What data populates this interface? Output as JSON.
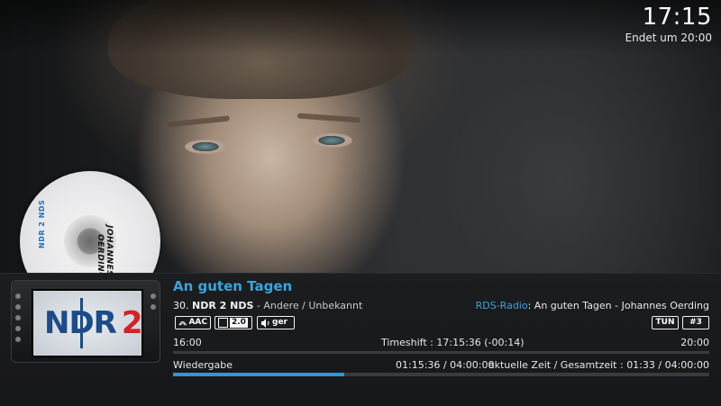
{
  "clock": {
    "time": "17:15",
    "ends_at": "Endet um 20:00"
  },
  "disc": {
    "station": "NDR 2 NDS",
    "artist_line1": "JOHANNES",
    "artist_line2": "OERDING"
  },
  "thumbnail": {
    "logo_ndr": "NDR",
    "logo_number": "2"
  },
  "now_playing": {
    "title": "An guten Tagen",
    "channel_number": "30",
    "channel_name": "NDR 2 NDS",
    "genre": "- Andere / Unbekannt",
    "rds_label": "RDS-Radio",
    "rds_text": ": An guten Tagen - Johannes Oerding"
  },
  "flags": {
    "codec": "AAC",
    "channels": "2.0",
    "language": "ger",
    "tuner": "TUN",
    "tuner_index": "#3"
  },
  "timeshift_row": {
    "start": "16:00",
    "timeshift": "Timeshift : 17:15:36 (-00:14)",
    "end": "20:00"
  },
  "playback_row": {
    "label": "Wiedergabe",
    "position": "01:15:36 / 04:00:00",
    "summary": "aktuelle Zeit / Gesamtzeit : 01:33 / 04:00:00",
    "progress": 0.32
  },
  "colors": {
    "accent": "#34a6df",
    "progress": "#2d97d3",
    "panel": "#1c1d1f"
  }
}
